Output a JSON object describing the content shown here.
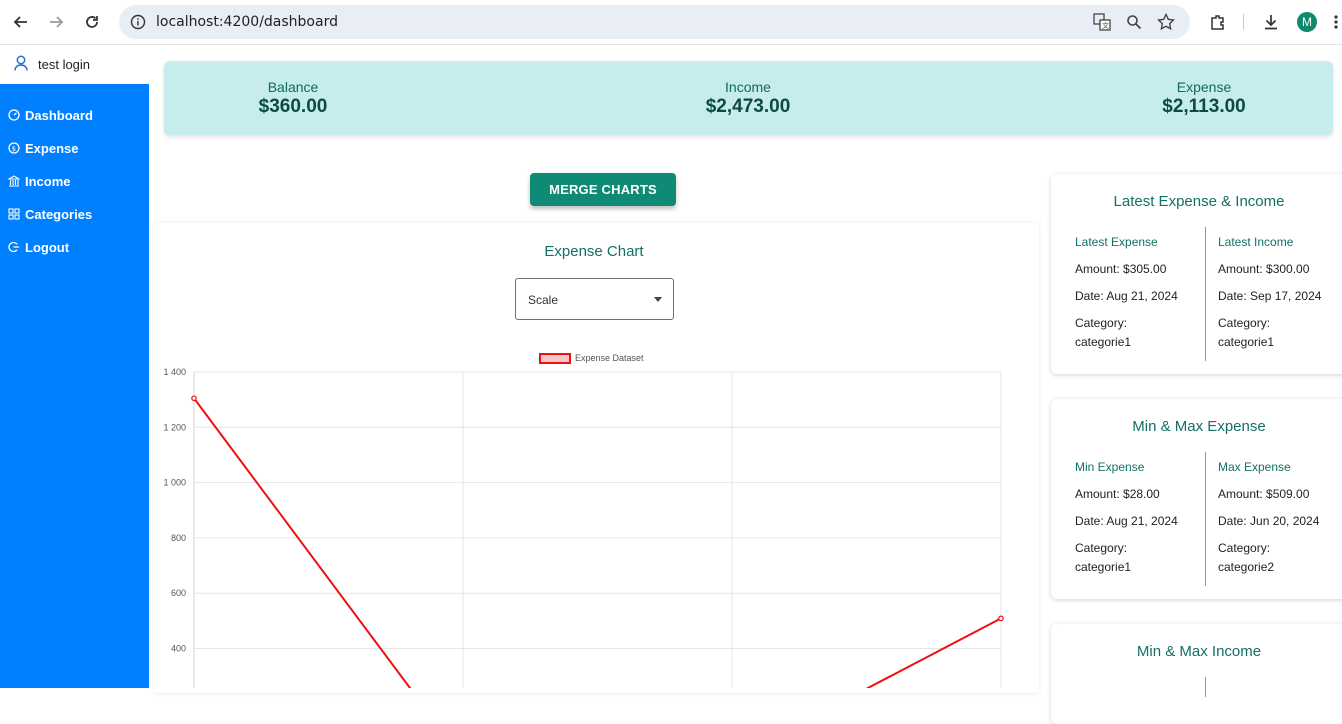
{
  "browser": {
    "url": "localhost:4200/dashboard",
    "profile_initial": "M"
  },
  "user": {
    "name": "test login"
  },
  "sidebar": {
    "items": [
      {
        "label": "Dashboard",
        "icon": "dashboard-icon"
      },
      {
        "label": "Expense",
        "icon": "dollar-icon"
      },
      {
        "label": "Income",
        "icon": "bank-icon"
      },
      {
        "label": "Categories",
        "icon": "grid-icon"
      },
      {
        "label": "Logout",
        "icon": "logout-icon"
      }
    ]
  },
  "summary": {
    "balance_label": "Balance",
    "balance_value": "$360.00",
    "income_label": "Income",
    "income_value": "$2,473.00",
    "expense_label": "Expense",
    "expense_value": "$2,113.00"
  },
  "main": {
    "merge_button": "MERGE CHARTS",
    "chart_title": "Expense Chart",
    "scale_select": "Scale"
  },
  "chart_data": {
    "type": "line",
    "series": [
      {
        "name": "Expense Dataset",
        "color": "#ee1111",
        "x_index": [
          0,
          1,
          2,
          3
        ],
        "values": [
          1305,
          0,
          0,
          509
        ]
      }
    ],
    "ylim": [
      0,
      1400
    ],
    "y_ticks": [
      "1 400",
      "1 200",
      "1 000",
      "800",
      "600",
      "400"
    ],
    "grid": true,
    "legend": "top-center"
  },
  "cards": {
    "latest": {
      "title": "Latest Expense & Income",
      "left": {
        "head": "Latest Expense",
        "amount": "Amount: $305.00",
        "date": "Date: Aug 21, 2024",
        "category_label": "Category:",
        "category": "categorie1"
      },
      "right": {
        "head": "Latest Income",
        "amount": "Amount: $300.00",
        "date": "Date: Sep 17, 2024",
        "category_label": "Category:",
        "category": "categorie1"
      }
    },
    "minmax_expense": {
      "title": "Min & Max Expense",
      "left": {
        "head": "Min Expense",
        "amount": "Amount: $28.00",
        "date": "Date: Aug 21, 2024",
        "category_label": "Category:",
        "category": "categorie1"
      },
      "right": {
        "head": "Max Expense",
        "amount": "Amount: $509.00",
        "date": "Date: Jun 20, 2024",
        "category_label": "Category:",
        "category": "categorie2"
      }
    },
    "minmax_income": {
      "title": "Min & Max Income"
    }
  }
}
